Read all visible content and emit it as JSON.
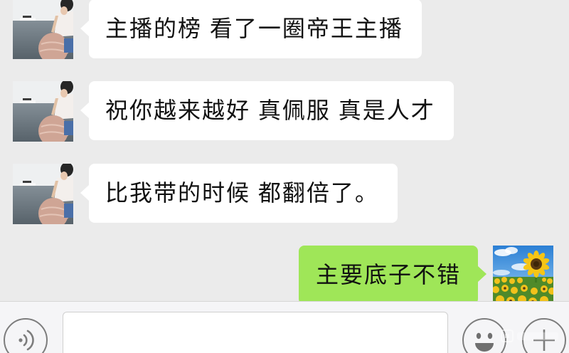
{
  "chat": {
    "messages": [
      {
        "side": "left",
        "sender": "friend",
        "text": "主播的榜 看了一圈帝王主播"
      },
      {
        "side": "left",
        "sender": "friend",
        "text": "祝你越来越好 真佩服 真是人才"
      },
      {
        "side": "left",
        "sender": "friend",
        "text": "比我带的时候 都翻倍了。"
      },
      {
        "side": "right",
        "sender": "self",
        "text": "主要底子不错"
      }
    ],
    "avatars": {
      "friend": "seaside-photo-avatar",
      "self": "sunflower-photo-avatar"
    }
  },
  "input_bar": {
    "input_value": "",
    "icons": {
      "voice": "voice-icon",
      "emoji": "emoji-icon",
      "more": "plus-icon"
    }
  },
  "colors": {
    "background": "#ebebeb",
    "bubble_incoming": "#ffffff",
    "bubble_outgoing": "#9fe658",
    "input_bar": "#f5f5f7",
    "icon_stroke": "#7d7d7d"
  }
}
